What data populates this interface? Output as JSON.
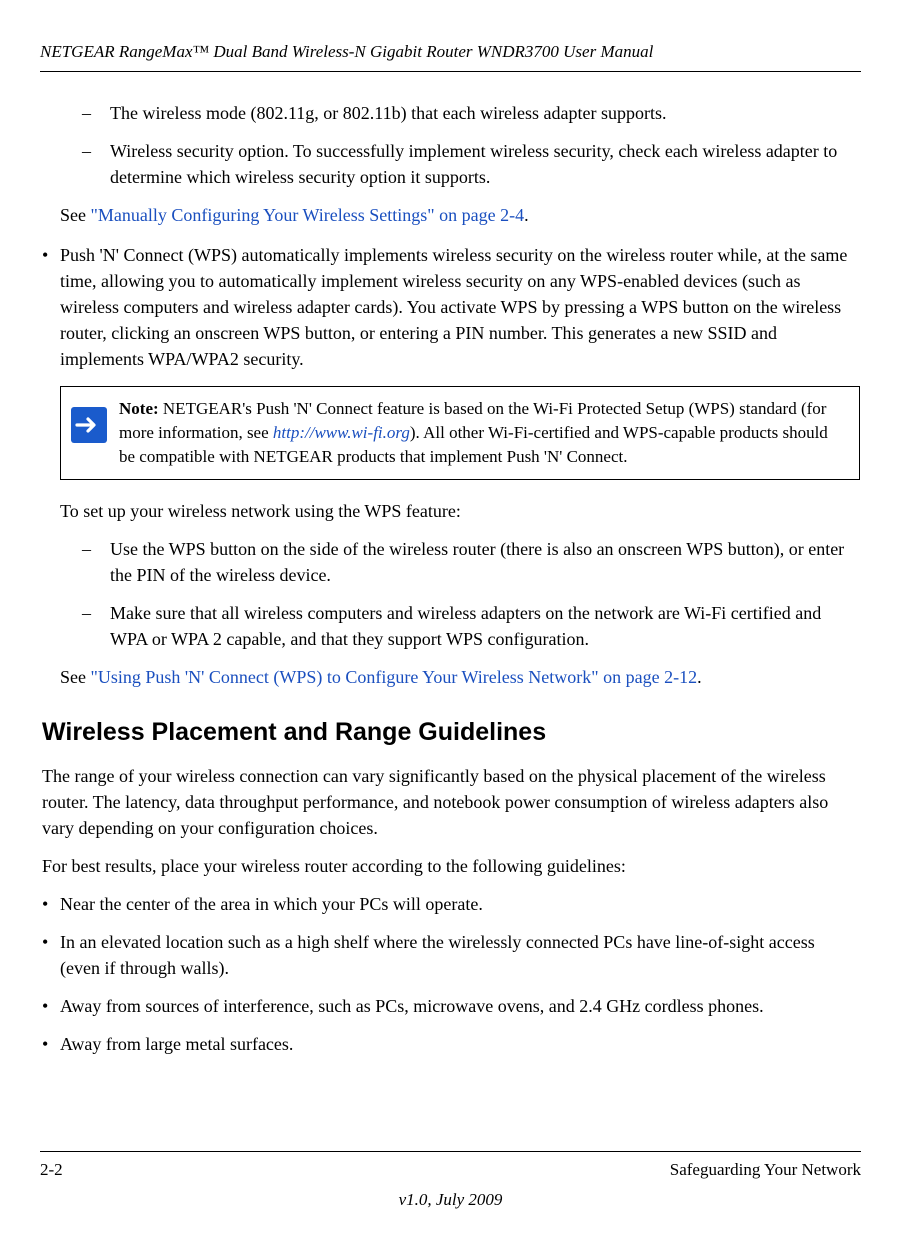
{
  "header": {
    "title": "NETGEAR RangeMax™ Dual Band Wireless-N Gigabit Router WNDR3700 User Manual"
  },
  "sub_items_top": [
    "The wireless mode (802.11g, or 802.11b) that each wireless adapter supports.",
    "Wireless security option. To successfully implement wireless security, check each wireless adapter to determine which wireless security option it supports."
  ],
  "see1_prefix": "See ",
  "see1_link": "\"Manually Configuring Your Wireless Settings\" on page 2-4",
  "see1_suffix": ".",
  "top_bullet": "Push 'N' Connect (WPS) automatically implements wireless security on the wireless router while, at the same time, allowing you to automatically implement wireless security on any WPS-enabled devices (such as wireless computers and wireless adapter cards). You activate WPS by pressing a WPS button on the wireless router, clicking an onscreen WPS button, or entering a PIN number. This generates a new SSID and implements WPA/WPA2 security.",
  "note": {
    "label": "Note:",
    "body_pre": " NETGEAR's Push 'N' Connect feature is based on the Wi-Fi Protected Setup (WPS) standard (for more information, see ",
    "body_link": "http://www.wi-fi.org",
    "body_post": "). All other Wi-Fi-certified and WPS-capable products should be compatible with NETGEAR products that implement Push 'N' Connect."
  },
  "after_note_para": "To set up your wireless network using the WPS feature:",
  "sub_items_mid": [
    "Use the WPS button on the side of the wireless router (there is also an onscreen WPS button), or enter the PIN of the wireless device.",
    "Make sure that all wireless computers and wireless adapters on the network are Wi-Fi certified and WPA or WPA 2 capable, and that they support WPS configuration."
  ],
  "see2_prefix": "See ",
  "see2_link": "\"Using Push 'N' Connect (WPS) to Configure Your Wireless Network\" on page 2-12",
  "see2_suffix": ".",
  "section_heading": "Wireless Placement and Range Guidelines",
  "body_para1": "The range of your wireless connection can vary significantly based on the physical placement of the wireless router. The latency, data throughput performance, and notebook power consumption of wireless adapters also vary depending on your configuration choices.",
  "body_para2": "For best results, place your wireless router according to the following guidelines:",
  "guidelines": [
    "Near the center of the area in which your PCs will operate.",
    "In an elevated location such as a high shelf where the wirelessly connected PCs have line-of-sight access (even if through walls).",
    "Away from sources of interference, such as PCs, microwave ovens, and 2.4 GHz cordless phones.",
    "Away from large metal surfaces."
  ],
  "footer": {
    "page": "2-2",
    "section": "Safeguarding Your Network",
    "version": "v1.0, July 2009"
  },
  "glyphs": {
    "dash": "–",
    "bullet": "•"
  }
}
